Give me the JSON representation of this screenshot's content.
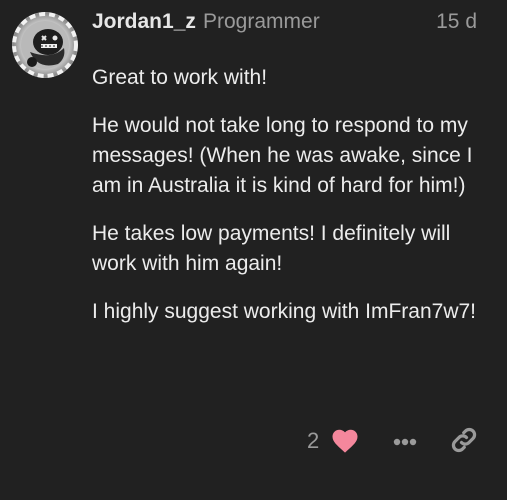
{
  "post": {
    "username": "Jordan1_z",
    "user_title": "Programmer",
    "date": "15 d",
    "paragraphs": [
      "Great to work with!",
      "He would not take long to respond to my messages! (When he was awake, since I am in Australia it is kind of hard for him!)",
      "He takes low payments! I definitely will work with him again!",
      "I highly suggest working with ImFran7w7!"
    ],
    "like_count": "2"
  },
  "colors": {
    "background": "#212121",
    "text": "#ececec",
    "muted": "#9a9a9a",
    "heart": "#f4879c"
  },
  "icons": {
    "like": "heart-icon",
    "more": "ellipsis-icon",
    "share": "link-icon"
  }
}
